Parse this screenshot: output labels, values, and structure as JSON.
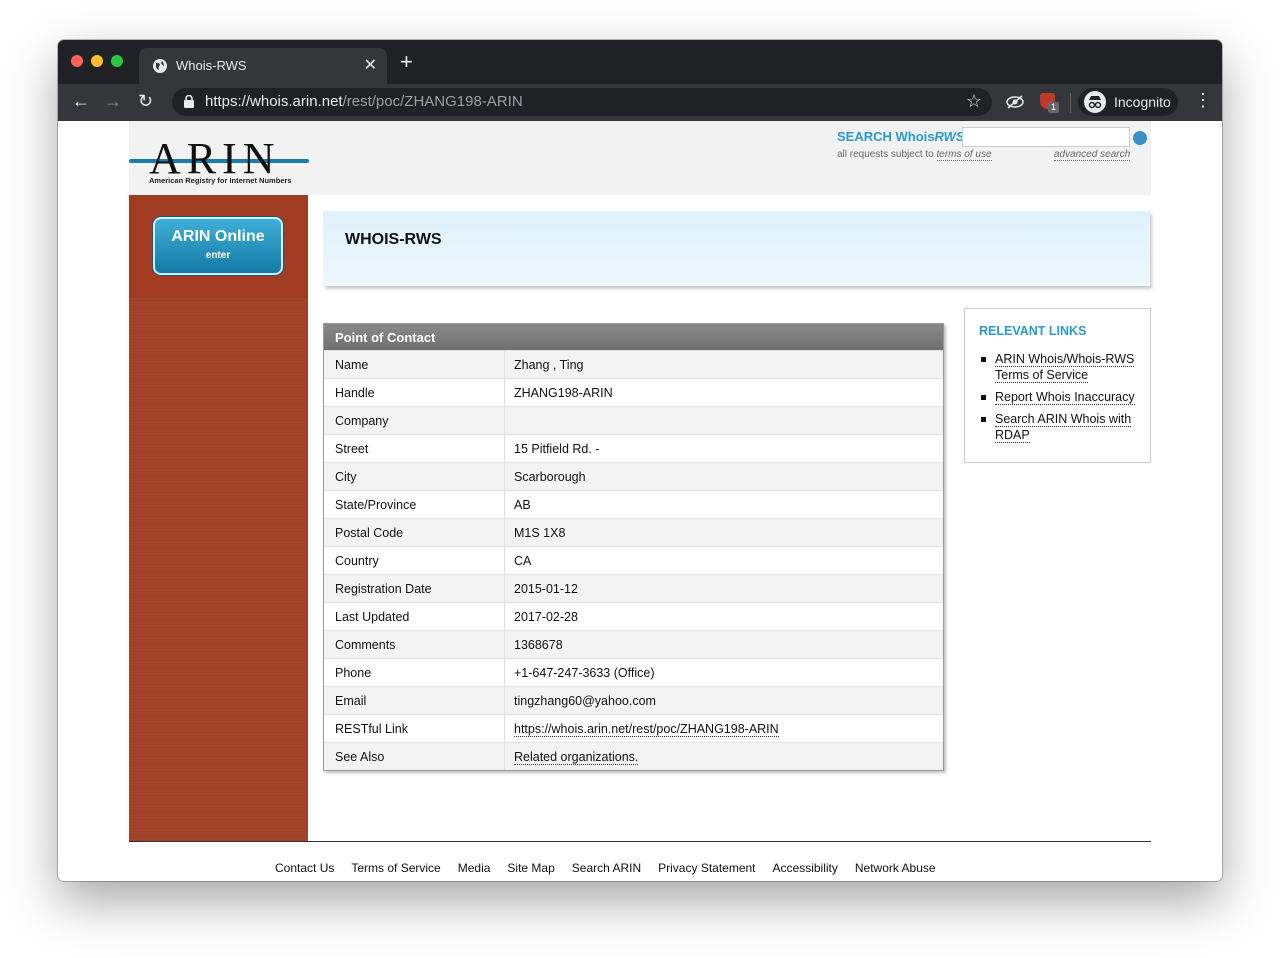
{
  "browser": {
    "tab_title": "Whois-RWS",
    "url_scheme": "https://",
    "url_host": "whois.arin.net",
    "url_path": "/rest/poc/ZHANG198-ARIN",
    "incognito_label": "Incognito",
    "extension_badge": "1"
  },
  "header": {
    "logo_text": "ARIN",
    "logo_subtitle": "American Registry for Internet Numbers",
    "search_label": "SEARCH Whois",
    "search_label_em": "RWS",
    "search_note": "all requests subject to",
    "terms_link": "terms of use",
    "advanced_link": "advanced search"
  },
  "sidebar": {
    "button_title": "ARIN Online",
    "button_sub": "enter"
  },
  "banner": {
    "title": "WHOIS-RWS"
  },
  "poc": {
    "heading": "Point of Contact",
    "rows": [
      {
        "label": "Name",
        "value": "Zhang , Ting"
      },
      {
        "label": "Handle",
        "value": "ZHANG198-ARIN"
      },
      {
        "label": "Company",
        "value": ""
      },
      {
        "label": "Street",
        "value": "15 Pitfield Rd. -"
      },
      {
        "label": "City",
        "value": "Scarborough"
      },
      {
        "label": "State/Province",
        "value": "AB"
      },
      {
        "label": "Postal Code",
        "value": "M1S 1X8"
      },
      {
        "label": "Country",
        "value": "CA"
      },
      {
        "label": "Registration Date",
        "value": "2015-01-12"
      },
      {
        "label": "Last Updated",
        "value": "2017-02-28"
      },
      {
        "label": "Comments",
        "value": "1368678"
      },
      {
        "label": "Phone",
        "value": "+1-647-247-3633 (Office)"
      },
      {
        "label": "Email",
        "value": "tingzhang60@yahoo.com"
      },
      {
        "label": "RESTful Link",
        "value": "https://whois.arin.net/rest/poc/ZHANG198-ARIN"
      },
      {
        "label": "See Also",
        "value": "Related organizations."
      }
    ]
  },
  "relevant": {
    "heading": "RELEVANT LINKS",
    "links": [
      "ARIN Whois/Whois-RWS Terms of Service",
      "Report Whois Inaccuracy",
      "Search ARIN Whois with RDAP"
    ]
  },
  "footer": {
    "links": [
      "Contact Us",
      "Terms of Service",
      "Media",
      "Site Map",
      "Search ARIN",
      "Privacy Statement",
      "Accessibility",
      "Network Abuse"
    ]
  },
  "colors": {
    "accent_blue": "#2a9ad0",
    "sidebar_red": "#a5432a",
    "browser_dark": "#202124"
  }
}
